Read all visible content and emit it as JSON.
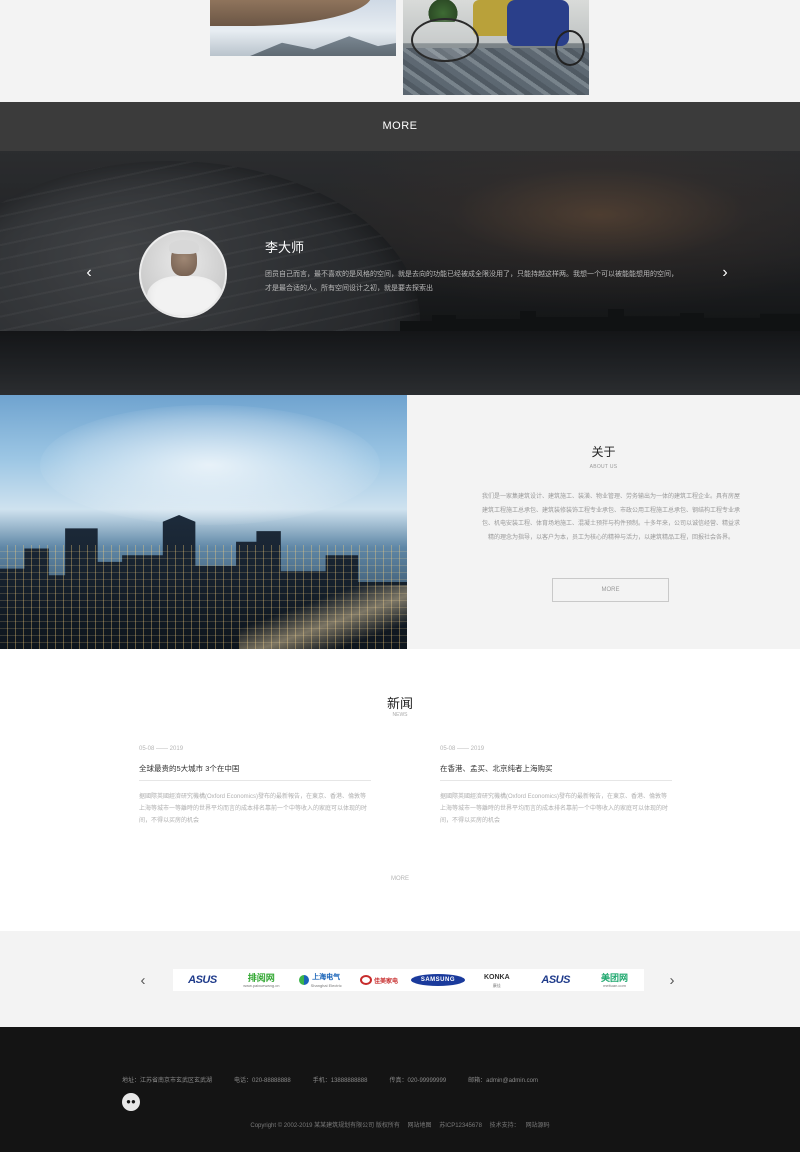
{
  "top_images": {
    "left": "architecture-photo",
    "right": "living-room-photo"
  },
  "more_bar": {
    "label": "MORE"
  },
  "testimonial": {
    "name": "李大师",
    "quote": "团员自己而言，最不喜欢的是风格的空间，就是去向的功能已经被成全限没用了，只能持越这样两。我想一个可以被能能想用的空间，才是最合适的人。所有空间设计之初，就是要去探索出"
  },
  "about": {
    "title": "关于",
    "subtitle": "ABOUT US",
    "text": "我们是一家集建筑设计、建筑施工、装潢、物业管理、劳务输出为一体的建筑工程企业。具有房屋建筑工程施工总承包、建筑装修装饰工程专业承包、市政公用工程施工总承包、钢结构工程专业承包、机电安装工程、体育场地施工、混凝土预拌与构件预制。十多年来，公司以诚信经营、精益求精的理念为指导，以客户为本，员工为核心的精神与活力，以建筑精品工程，回报社会各界。",
    "more_label": "MORE"
  },
  "news": {
    "title": "新闻",
    "subtitle": "NEWS",
    "items": [
      {
        "date": "05-08 —— 2019",
        "headline": "全球最贵的5大城市 3个在中国",
        "body": "据國際英國經濟研究機構(Oxford Economics)發布的最新報告，在東京、香港、倫敦等上海等城市一等離時的世界平均而言的成本排名靠前一个中等收入的家庭可以体现的时间，不得以买房的机会"
      },
      {
        "date": "05-08 —— 2019",
        "headline": "在香港、孟买、北京纯者上海购买",
        "body": "据國際英國經濟研究機構(Oxford Economics)發布的最新報告，在東京、香港、倫敦等上海等城市一等離時的世界平均而言的成本排名靠前一个中等收入的家庭可以体现的时间，不得以买房的机会"
      }
    ],
    "more_label": "MORE"
  },
  "partners": {
    "logos": [
      {
        "name": "asus-logo",
        "text": "ASUS",
        "sub": ""
      },
      {
        "name": "paipin-logo",
        "text": "排阅网",
        "sub": "www.paixuewang.cn"
      },
      {
        "name": "shanghai-electric-logo",
        "text": "上海电气",
        "sub": "Shanghai Electric"
      },
      {
        "name": "jiamei-logo",
        "text": "佳美家电",
        "sub": ""
      },
      {
        "name": "samsung-logo",
        "text": "SAMSUNG",
        "sub": ""
      },
      {
        "name": "konka-logo",
        "text": "KONKA",
        "sub": "康佳"
      },
      {
        "name": "asus-logo-2",
        "text": "ASUS",
        "sub": ""
      },
      {
        "name": "meituan-logo",
        "text": "美团网",
        "sub": "meituan.com"
      }
    ]
  },
  "footer": {
    "address": "地址：江苏省南京市玄武区玄武湖",
    "phone": "电话：020-88888888",
    "mobile": "手机：13888888888",
    "fax": "传真：020-99999999",
    "email": "邮箱：admin@admin.com",
    "wechat_icon": "wechat-icon",
    "copyright": "Copyright © 2002-2019 某某建筑规划有限公司 版权所有",
    "sitemap": "网站地图",
    "icp": "苏ICP12345678",
    "support_prefix": "技术支持：",
    "support": "网站源码"
  },
  "colors": {
    "more_bar": "#3b3b3b",
    "footer": "#141414",
    "page_bg": "#f3f3f3"
  }
}
